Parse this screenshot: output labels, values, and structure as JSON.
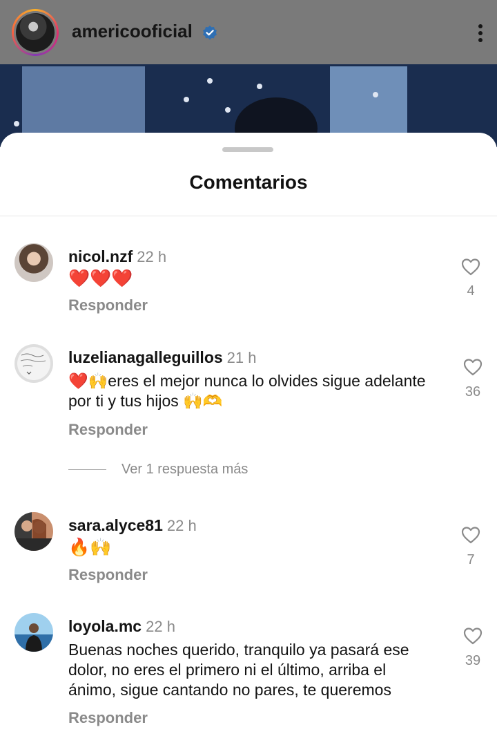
{
  "header": {
    "account_name": "americooficial"
  },
  "sheet": {
    "title": "Comentarios"
  },
  "comments": [
    {
      "username": "nicol.nzf",
      "time": "22 h",
      "text": "❤️❤️❤️",
      "reply_label": "Responder",
      "likes": "4"
    },
    {
      "username": "luzelianagalleguillos",
      "time": "21 h",
      "text_line1": "❤️🙌eres el mejor nunca lo olvides sigue adelante",
      "text_line2": "por ti y tus hijos 🙌🫶",
      "reply_label": "Responder",
      "likes": "36",
      "more_replies": "Ver 1 respuesta más"
    },
    {
      "username": "sara.alyce81",
      "time": "22 h",
      "text": "🔥🙌",
      "reply_label": "Responder",
      "likes": "7"
    },
    {
      "username": "loyola.mc",
      "time": "22 h",
      "text_line1": "Buenas noches querido, tranquilo ya pasará ese",
      "text_line2": "dolor, no eres el primero ni el último,  arriba el",
      "text_line3": "ánimo, sigue cantando no pares, te queremos",
      "reply_label": "Responder",
      "likes": "39"
    }
  ],
  "icons": {
    "verified": "verified-badge-icon",
    "more": "more-vertical-icon",
    "like": "heart-outline-icon"
  },
  "colors": {
    "verified_blue": "#3897f0",
    "muted_text": "#8a8a8a"
  }
}
